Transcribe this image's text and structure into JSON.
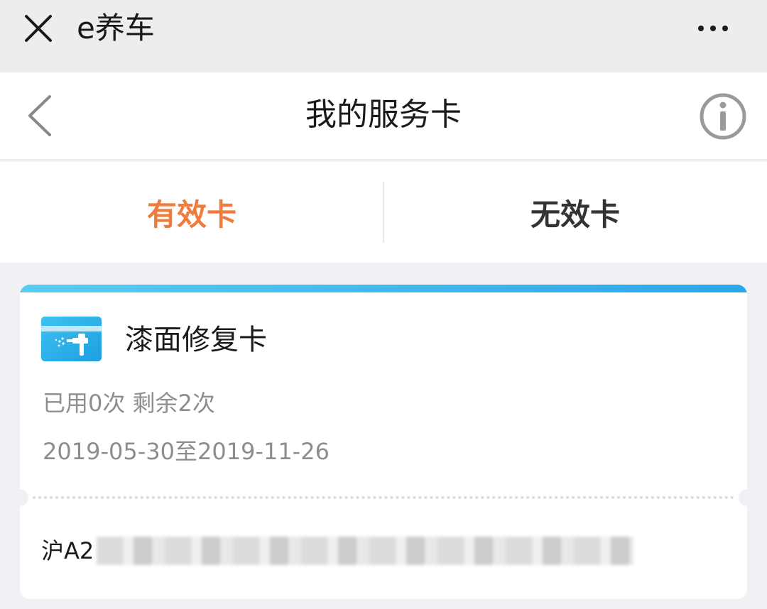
{
  "topbar": {
    "app_title": "e养车"
  },
  "navbar": {
    "title": "我的服务卡"
  },
  "tabs": [
    {
      "label": "有效卡",
      "active": true
    },
    {
      "label": "无效卡",
      "active": false
    }
  ],
  "card": {
    "name": "漆面修复卡",
    "usage": "已用0次 剩余2次",
    "validity": "2019-05-30至2019-11-26",
    "plate_prefix": "沪A2"
  },
  "colors": {
    "accent_orange": "#ef7b3d",
    "card_top_blue": "#2aa6ec",
    "background": "#f1f0f5"
  },
  "icons": [
    "close-icon",
    "more-icon",
    "chevron-left-icon",
    "info-icon",
    "spray-gun-card-icon"
  ]
}
